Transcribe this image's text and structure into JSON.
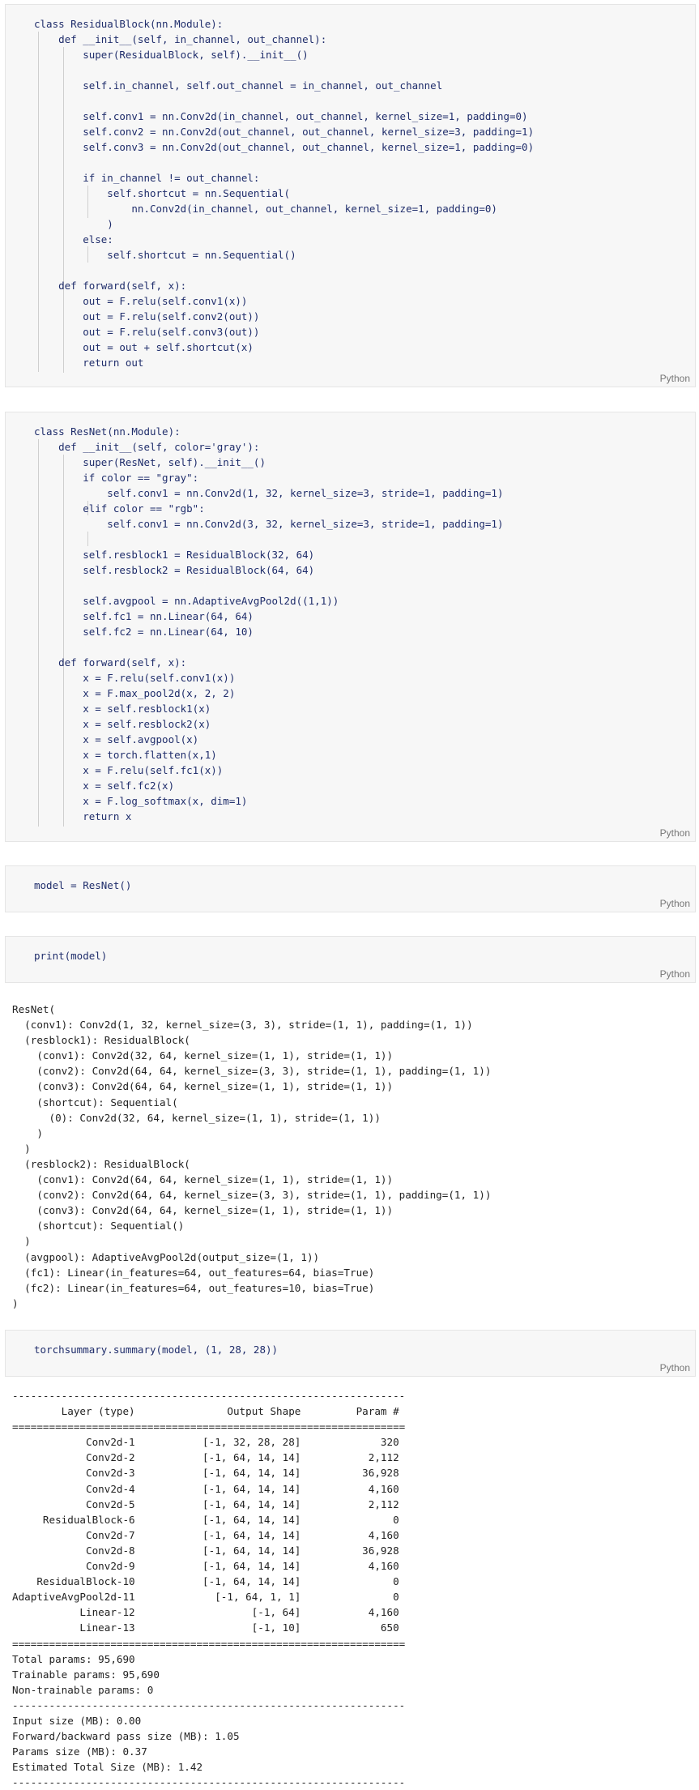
{
  "cells": [
    {
      "language": "Python",
      "code": "class ResidualBlock(nn.Module):\n    def __init__(self, in_channel, out_channel):\n        super(ResidualBlock, self).__init__()\n\n        self.in_channel, self.out_channel = in_channel, out_channel\n\n        self.conv1 = nn.Conv2d(in_channel, out_channel, kernel_size=1, padding=0)\n        self.conv2 = nn.Conv2d(out_channel, out_channel, kernel_size=3, padding=1)\n        self.conv3 = nn.Conv2d(out_channel, out_channel, kernel_size=1, padding=0)\n\n        if in_channel != out_channel:\n            self.shortcut = nn.Sequential(\n                nn.Conv2d(in_channel, out_channel, kernel_size=1, padding=0)\n            )\n        else:\n            self.shortcut = nn.Sequential()\n\n    def forward(self, x):\n        out = F.relu(self.conv1(x))\n        out = F.relu(self.conv2(out))\n        out = F.relu(self.conv3(out))\n        out = out + self.shortcut(x)\n        return out"
    },
    {
      "language": "Python",
      "code": "class ResNet(nn.Module):\n    def __init__(self, color='gray'):\n        super(ResNet, self).__init__()\n        if color == \"gray\":\n            self.conv1 = nn.Conv2d(1, 32, kernel_size=3, stride=1, padding=1)\n        elif color == \"rgb\":\n            self.conv1 = nn.Conv2d(3, 32, kernel_size=3, stride=1, padding=1)\n\n        self.resblock1 = ResidualBlock(32, 64)\n        self.resblock2 = ResidualBlock(64, 64)\n\n        self.avgpool = nn.AdaptiveAvgPool2d((1,1))\n        self.fc1 = nn.Linear(64, 64)\n        self.fc2 = nn.Linear(64, 10)\n\n    def forward(self, x):\n        x = F.relu(self.conv1(x))\n        x = F.max_pool2d(x, 2, 2)\n        x = self.resblock1(x)\n        x = self.resblock2(x)\n        x = self.avgpool(x)\n        x = torch.flatten(x,1)\n        x = F.relu(self.fc1(x))\n        x = self.fc2(x)\n        x = F.log_softmax(x, dim=1)\n        return x"
    },
    {
      "language": "Python",
      "code": "model = ResNet()"
    },
    {
      "language": "Python",
      "code": "print(model)",
      "output": "ResNet(\n  (conv1): Conv2d(1, 32, kernel_size=(3, 3), stride=(1, 1), padding=(1, 1))\n  (resblock1): ResidualBlock(\n    (conv1): Conv2d(32, 64, kernel_size=(1, 1), stride=(1, 1))\n    (conv2): Conv2d(64, 64, kernel_size=(3, 3), stride=(1, 1), padding=(1, 1))\n    (conv3): Conv2d(64, 64, kernel_size=(1, 1), stride=(1, 1))\n    (shortcut): Sequential(\n      (0): Conv2d(32, 64, kernel_size=(1, 1), stride=(1, 1))\n    )\n  )\n  (resblock2): ResidualBlock(\n    (conv1): Conv2d(64, 64, kernel_size=(1, 1), stride=(1, 1))\n    (conv2): Conv2d(64, 64, kernel_size=(3, 3), stride=(1, 1), padding=(1, 1))\n    (conv3): Conv2d(64, 64, kernel_size=(1, 1), stride=(1, 1))\n    (shortcut): Sequential()\n  )\n  (avgpool): AdaptiveAvgPool2d(output_size=(1, 1))\n  (fc1): Linear(in_features=64, out_features=64, bias=True)\n  (fc2): Linear(in_features=64, out_features=10, bias=True)\n)"
    },
    {
      "language": "Python",
      "code": "torchsummary.summary(model, (1, 28, 28))",
      "output": "----------------------------------------------------------------\n        Layer (type)               Output Shape         Param #\n================================================================\n            Conv2d-1           [-1, 32, 28, 28]             320\n            Conv2d-2           [-1, 64, 14, 14]           2,112\n            Conv2d-3           [-1, 64, 14, 14]          36,928\n            Conv2d-4           [-1, 64, 14, 14]           4,160\n            Conv2d-5           [-1, 64, 14, 14]           2,112\n     ResidualBlock-6           [-1, 64, 14, 14]               0\n            Conv2d-7           [-1, 64, 14, 14]           4,160\n            Conv2d-8           [-1, 64, 14, 14]          36,928\n            Conv2d-9           [-1, 64, 14, 14]           4,160\n    ResidualBlock-10           [-1, 64, 14, 14]               0\nAdaptiveAvgPool2d-11             [-1, 64, 1, 1]               0\n           Linear-12                   [-1, 64]           4,160\n           Linear-13                   [-1, 10]             650\n================================================================\nTotal params: 95,690\nTrainable params: 95,690\nNon-trainable params: 0\n----------------------------------------------------------------\nInput size (MB): 0.00\nForward/backward pass size (MB): 1.05\nParams size (MB): 0.37\nEstimated Total Size (MB): 1.42\n----------------------------------------------------------------"
    }
  ]
}
